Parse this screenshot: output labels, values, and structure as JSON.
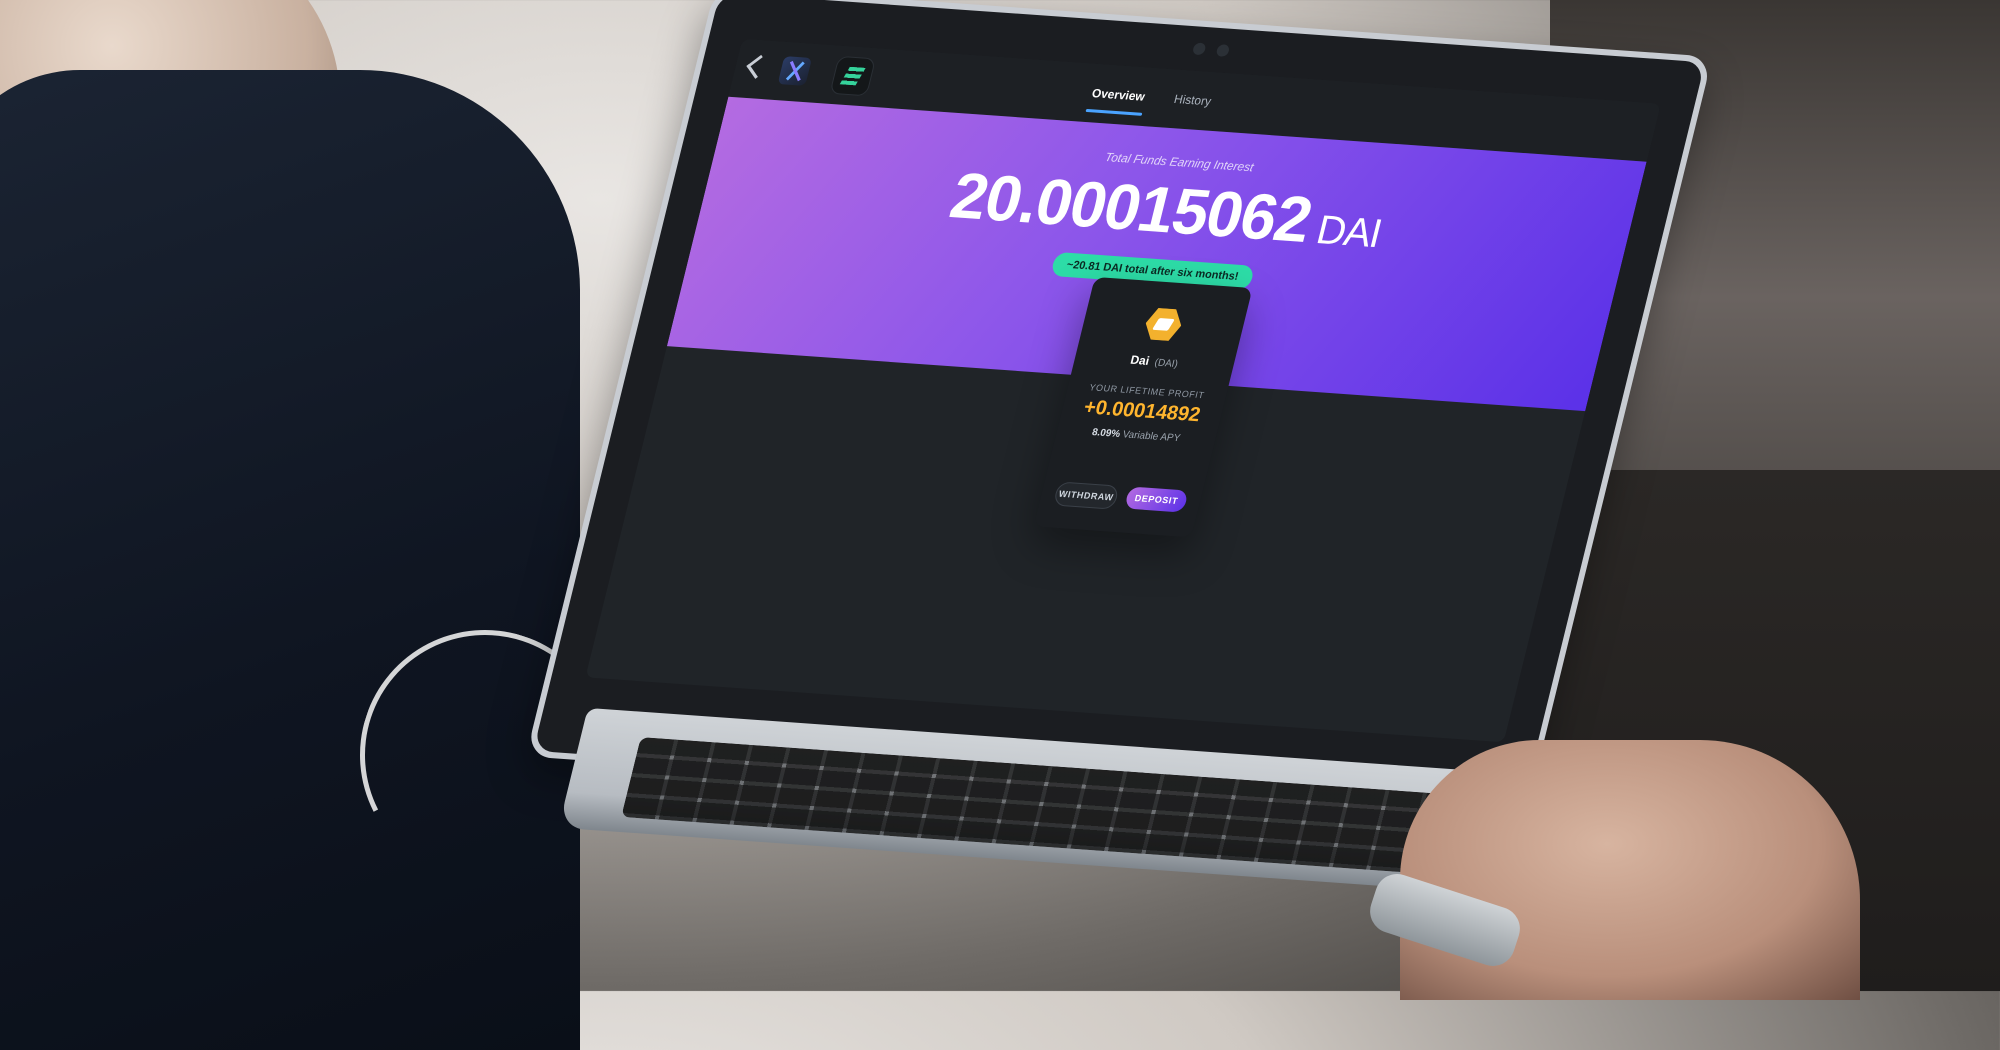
{
  "app": {
    "tabs": [
      {
        "label": "Overview"
      },
      {
        "label": "History"
      }
    ]
  },
  "hero": {
    "label": "Total Funds Earning Interest",
    "amount": "20.00015062",
    "unit": "DAI",
    "projection_pill": "~20.81 DAI total after six months!"
  },
  "asset_card": {
    "name": "Dai",
    "ticker": "(DAI)",
    "profit_label": "YOUR LIFETIME PROFIT",
    "profit_value": "+0.00014892",
    "apy_value": "8.09%",
    "apy_label": "Variable APY",
    "withdraw_label": "WITHDRAW",
    "deposit_label": "DEPOSIT"
  },
  "icons": {
    "back": "back-chevron-icon",
    "brand": "brand-mark-icon",
    "app": "app-logo-icon",
    "undo": "history-icon",
    "settings": "settings-icon",
    "shield": "security-icon",
    "grid": "apps-grid-icon",
    "coin": "dai-coin-icon"
  },
  "colors": {
    "hero_gradient_start": "#b46be1",
    "hero_gradient_end": "#5b31e8",
    "pill_bg": "#2ddca7",
    "profit": "#ffb52e",
    "screen_bg": "#202428"
  }
}
